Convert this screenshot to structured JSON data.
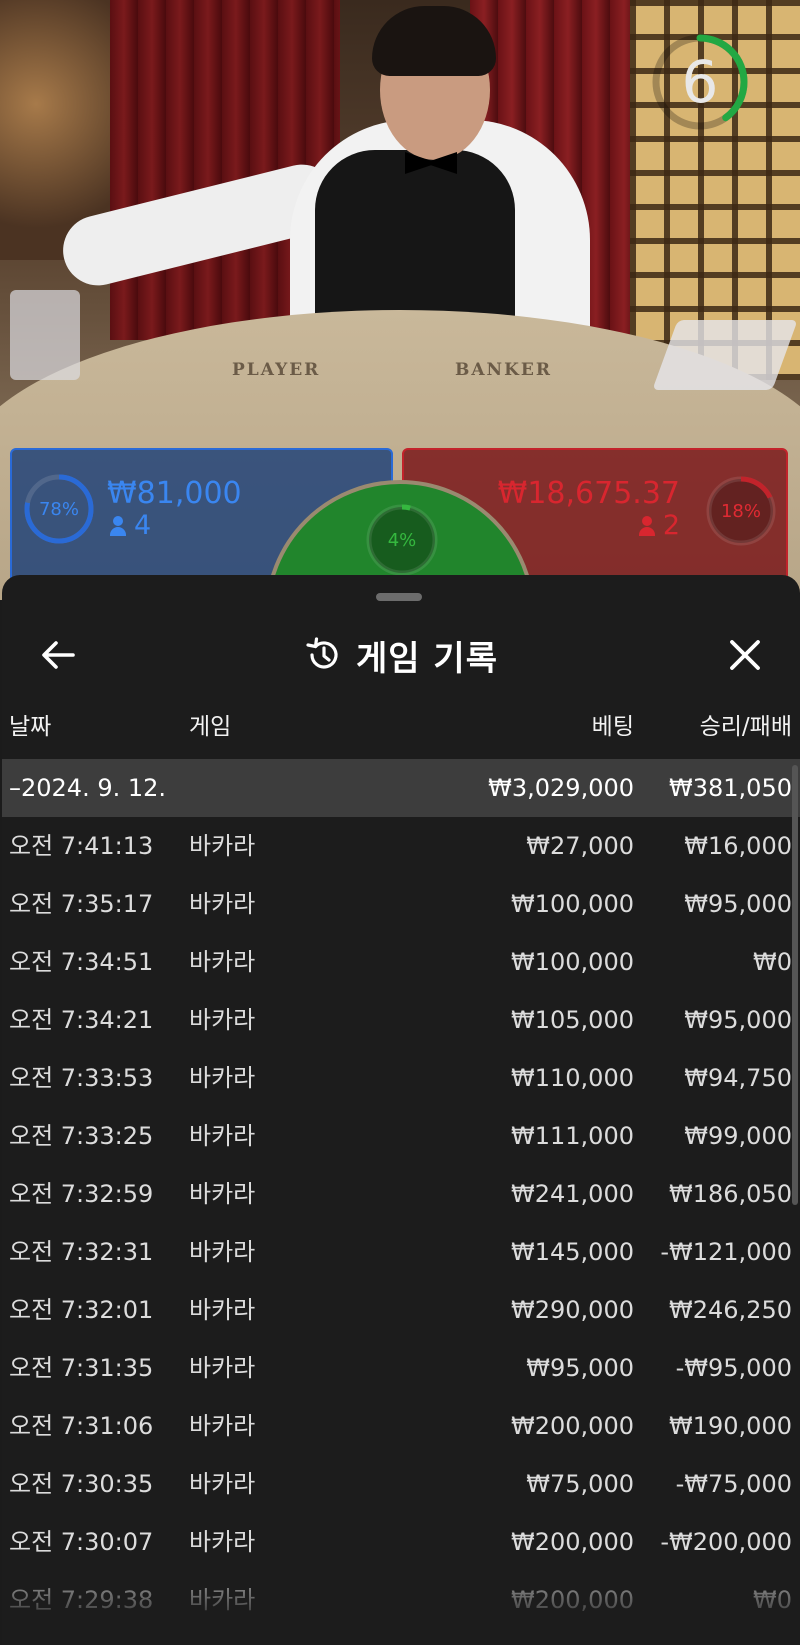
{
  "video": {
    "countdown": "6",
    "countdown_fraction": 0.4,
    "felt_player_label": "PLAYER",
    "felt_banker_label": "BANKER",
    "player_panel": {
      "percent": "78%",
      "percent_value": 0.78,
      "amount": "₩81,000",
      "bettors": "4",
      "color": "#2a6ad6"
    },
    "tie_panel": {
      "percent": "4%",
      "percent_value": 0.04,
      "color": "#35b83f"
    },
    "banker_panel": {
      "percent": "18%",
      "percent_value": 0.18,
      "amount": "₩18,675.37",
      "bettors": "2",
      "color": "#c2232b"
    }
  },
  "sheet": {
    "title": "게임 기록",
    "back_icon": "arrow-left-icon",
    "history_icon": "history-icon",
    "close_icon": "close-icon",
    "columns": {
      "date": "날짜",
      "game": "게임",
      "bet": "베팅",
      "win_loss": "승리/패배"
    },
    "group": {
      "date": "–2024. 9. 12.",
      "bet": "₩3,029,000",
      "win_loss": "₩381,050"
    },
    "rows": [
      {
        "time": "오전 7:41:13",
        "game": "바카라",
        "bet": "₩27,000",
        "win_loss": "₩16,000"
      },
      {
        "time": "오전 7:35:17",
        "game": "바카라",
        "bet": "₩100,000",
        "win_loss": "₩95,000"
      },
      {
        "time": "오전 7:34:51",
        "game": "바카라",
        "bet": "₩100,000",
        "win_loss": "₩0"
      },
      {
        "time": "오전 7:34:21",
        "game": "바카라",
        "bet": "₩105,000",
        "win_loss": "₩95,000"
      },
      {
        "time": "오전 7:33:53",
        "game": "바카라",
        "bet": "₩110,000",
        "win_loss": "₩94,750"
      },
      {
        "time": "오전 7:33:25",
        "game": "바카라",
        "bet": "₩111,000",
        "win_loss": "₩99,000"
      },
      {
        "time": "오전 7:32:59",
        "game": "바카라",
        "bet": "₩241,000",
        "win_loss": "₩186,050"
      },
      {
        "time": "오전 7:32:31",
        "game": "바카라",
        "bet": "₩145,000",
        "win_loss": "-₩121,000"
      },
      {
        "time": "오전 7:32:01",
        "game": "바카라",
        "bet": "₩290,000",
        "win_loss": "₩246,250"
      },
      {
        "time": "오전 7:31:35",
        "game": "바카라",
        "bet": "₩95,000",
        "win_loss": "-₩95,000"
      },
      {
        "time": "오전 7:31:06",
        "game": "바카라",
        "bet": "₩200,000",
        "win_loss": "₩190,000"
      },
      {
        "time": "오전 7:30:35",
        "game": "바카라",
        "bet": "₩75,000",
        "win_loss": "-₩75,000"
      },
      {
        "time": "오전 7:30:07",
        "game": "바카라",
        "bet": "₩200,000",
        "win_loss": "-₩200,000"
      },
      {
        "time": "오전 7:29:38",
        "game": "바카라",
        "bet": "₩200,000",
        "win_loss": "₩0"
      }
    ]
  }
}
